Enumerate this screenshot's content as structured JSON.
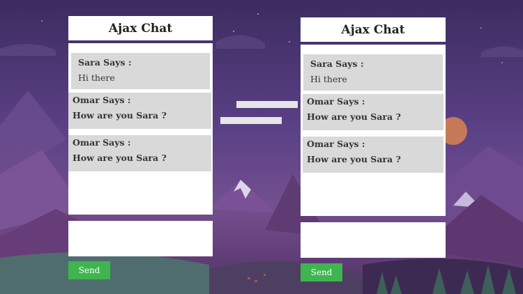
{
  "chats": [
    {
      "title": "Ajax Chat",
      "messages": [
        {
          "sender": "Sara Says :",
          "text": "Hi there"
        },
        {
          "sender": "Omar Says :",
          "text": "How are you Sara ?"
        },
        {
          "sender": "Omar Says :",
          "text": "How are you Sara ?"
        }
      ],
      "input_value": "",
      "send_label": "Send"
    },
    {
      "title": "Ajax Chat",
      "messages": [
        {
          "sender": "Sara Says :",
          "text": "Hi there"
        },
        {
          "sender": "Omar Says :",
          "text": "How are you Sara ?"
        },
        {
          "sender": "Omar Says :",
          "text": "How are you Sara ?"
        }
      ],
      "input_value": "",
      "send_label": "Send"
    }
  ],
  "colors": {
    "send_button": "#3fb54f",
    "message_bg": "#d9d9d9",
    "panel_bg": "#ffffff"
  }
}
